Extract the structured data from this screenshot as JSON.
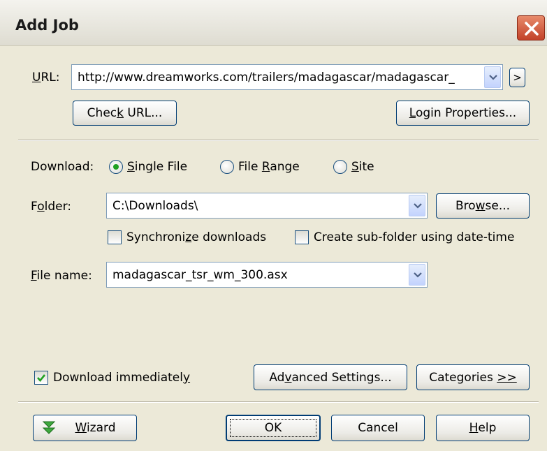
{
  "window": {
    "title": "Add Job",
    "close_icon": "close-icon"
  },
  "url": {
    "label": "URL:",
    "value": "http://www.dreamworks.com/trailers/madagascar/madagascar_",
    "go_label": ">",
    "check_button": "Check URL...",
    "login_button": "Login Properties..."
  },
  "download": {
    "label": "Download:",
    "options": [
      "Single File",
      "File Range",
      "Site"
    ],
    "selected": "Single File"
  },
  "folder": {
    "label": "Folder:",
    "value": "C:\\Downloads\\",
    "browse_button": "Browse...",
    "sync_label": "Synchronize downloads",
    "subfolder_label": "Create sub-folder using date-time"
  },
  "file": {
    "label": "File name:",
    "value": "madagascar_tsr_wm_300.asx"
  },
  "options": {
    "download_immediately": "Download immediately",
    "download_immediately_checked": true,
    "advanced_button": "Advanced Settings...",
    "categories_button": "Categories >>"
  },
  "footer": {
    "wizard_button": "Wizard",
    "ok_button": "OK",
    "cancel_button": "Cancel",
    "help_button": "Help"
  },
  "colors": {
    "accent": "#003c74",
    "radio_dot": "#21a121",
    "close_red": "#c2422a"
  }
}
